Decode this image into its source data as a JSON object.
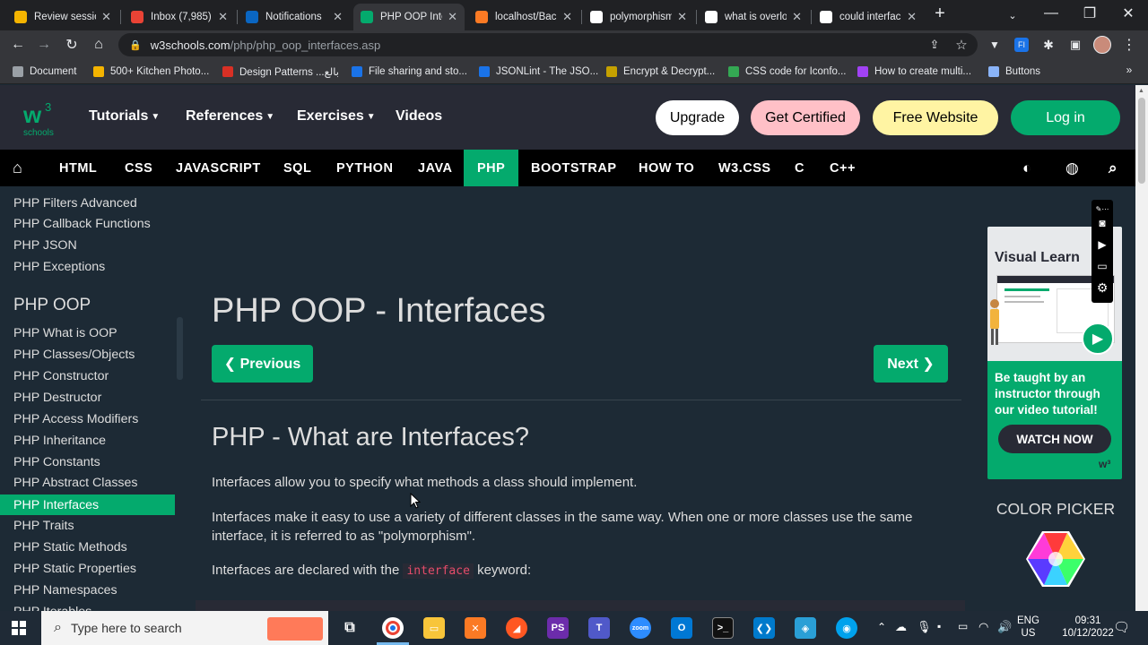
{
  "browser": {
    "tabs": [
      {
        "title": "Review sessio",
        "icon": "google-drive-icon",
        "color": "#f4b400"
      },
      {
        "title": "Inbox (7,985)",
        "icon": "gmail-icon",
        "color": "#ea4335"
      },
      {
        "title": "Notifications",
        "icon": "linkedin-icon",
        "color": "#0a66c2"
      },
      {
        "title": "PHP OOP Inte",
        "icon": "w3schools-icon",
        "color": "#04aa6d",
        "active": true
      },
      {
        "title": "localhost/Bac",
        "icon": "xampp-icon",
        "color": "#fb7a24"
      },
      {
        "title": "polymorphism",
        "icon": "google-icon",
        "color": "#ffffff"
      },
      {
        "title": "what is overlo",
        "icon": "google-icon",
        "color": "#ffffff"
      },
      {
        "title": "could interfac",
        "icon": "google-icon",
        "color": "#ffffff"
      }
    ],
    "url_host": "w3schools.com",
    "url_path": "/php/php_oop_interfaces.asp",
    "bookmarks": [
      {
        "label": "Document",
        "color": "#9aa0a6"
      },
      {
        "label": "500+ Kitchen Photo...",
        "color": "#f4b400"
      },
      {
        "label": "Design Patterns ...بالع",
        "color": "#d93025"
      },
      {
        "label": "File sharing and sto...",
        "color": "#1a73e8"
      },
      {
        "label": "JSONLint - The JSO...",
        "color": "#1a73e8"
      },
      {
        "label": "Encrypt & Decrypt...",
        "color": "#c5a100"
      },
      {
        "label": "CSS code for Iconfo...",
        "color": "#34a853"
      },
      {
        "label": "How to create multi...",
        "color": "#a142f4"
      },
      {
        "label": "Buttons",
        "color": "#8ab4f8"
      }
    ]
  },
  "w3": {
    "logo_text": "w3",
    "logo_sub": "schools",
    "top_nav": [
      "Tutorials",
      "References",
      "Exercises",
      "Videos"
    ],
    "buttons": {
      "upgrade": "Upgrade",
      "certified": "Get Certified",
      "website": "Free Website",
      "login": "Log in"
    },
    "languages": [
      "HTML",
      "CSS",
      "JAVASCRIPT",
      "SQL",
      "PYTHON",
      "JAVA",
      "PHP",
      "BOOTSTRAP",
      "HOW TO",
      "W3.CSS",
      "C",
      "C++"
    ],
    "active_language": "PHP",
    "colors": {
      "accent": "#04aa6d",
      "header_bg": "#282a35",
      "page_bg": "#1d2a35"
    }
  },
  "sidebar": {
    "items_top": [
      "PHP Filters Advanced",
      "PHP Callback Functions",
      "PHP JSON",
      "PHP Exceptions"
    ],
    "section_heading": "PHP OOP",
    "items_oop": [
      "PHP What is OOP",
      "PHP Classes/Objects",
      "PHP Constructor",
      "PHP Destructor",
      "PHP Access Modifiers",
      "PHP Inheritance",
      "PHP Constants",
      "PHP Abstract Classes",
      "PHP Interfaces",
      "PHP Traits",
      "PHP Static Methods",
      "PHP Static Properties",
      "PHP Namespaces",
      "PHP Iterables"
    ],
    "active_item": "PHP Interfaces"
  },
  "main": {
    "title": "PHP OOP - Interfaces",
    "prev_label": "❮ Previous",
    "next_label": "Next ❯",
    "h2": "PHP - What are Interfaces?",
    "p1": "Interfaces allow you to specify what methods a class should implement.",
    "p2": "Interfaces make it easy to use a variety of different classes in the same way. When one or more classes use the same interface, it is referred to as \"polymorphism\".",
    "p3_before": "Interfaces are declared with the",
    "p3_code": "interface",
    "p3_after": "keyword:"
  },
  "ad": {
    "title": "Visual Learn",
    "text": "Be taught by an instructor through our video tutorial!",
    "cta": "WATCH NOW"
  },
  "color_picker": {
    "title": "COLOR PICKER"
  },
  "taskbar": {
    "search_placeholder": "Type here to search",
    "lang_line1": "ENG",
    "lang_line2": "US",
    "time": "09:31",
    "date": "10/12/2022"
  }
}
